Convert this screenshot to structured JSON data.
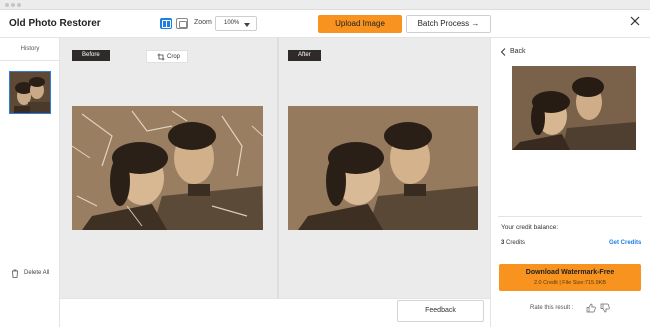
{
  "app": {
    "title": "Old Photo Restorer"
  },
  "toolbar": {
    "zoom_label": "Zoom",
    "zoom_value": "100%",
    "upload_label": "Upload Image",
    "batch_label": "Batch Process →"
  },
  "history": {
    "title": "History",
    "delete_label": "Delete All"
  },
  "canvas": {
    "before_label": "Before",
    "after_label": "After",
    "crop_label": "Crop"
  },
  "panel": {
    "back_label": "Back",
    "credit_title": "Your credit balance:",
    "credit_count": "3",
    "credit_unit": "Credits",
    "get_credits_label": "Get Credits",
    "download_label": "Download Watermark-Free",
    "download_sub": "2.0 Credit | File Size:715.9KB",
    "rate_label": "Rate this result :"
  },
  "feedback_label": "Feedback",
  "icons": [
    "split-view-icon",
    "single-view-icon",
    "chevron-down-icon",
    "close-icon",
    "crop-icon",
    "trash-icon",
    "chevron-left-icon",
    "thumbs-up-icon",
    "thumbs-down-icon"
  ],
  "colors": {
    "accent": "#f7931e",
    "link": "#1f7fe0",
    "selected": "#2a7de1"
  }
}
